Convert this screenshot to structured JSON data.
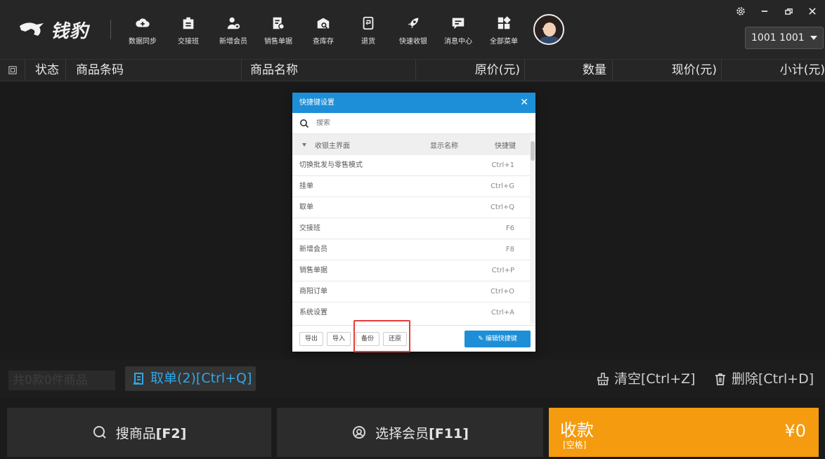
{
  "app": {
    "logo_text": "钱豹"
  },
  "toolbar": [
    {
      "label": "数据同步",
      "icon": "cloud-sync-icon"
    },
    {
      "label": "交接班",
      "icon": "handover-icon"
    },
    {
      "label": "新增会员",
      "icon": "add-member-icon"
    },
    {
      "label": "销售单据",
      "icon": "sales-doc-icon"
    },
    {
      "label": "查库存",
      "icon": "inventory-icon"
    },
    {
      "label": "退货",
      "icon": "return-icon"
    },
    {
      "label": "快速收银",
      "icon": "rocket-icon"
    },
    {
      "label": "消息中心",
      "icon": "message-icon"
    },
    {
      "label": "全部菜单",
      "icon": "grid-menu-icon"
    }
  ],
  "user": {
    "selector": "1001 1001"
  },
  "table": {
    "headers": [
      "状态",
      "商品条码",
      "商品名称",
      "原价(元)",
      "数量",
      "现价(元)",
      "小计(元)"
    ]
  },
  "summary": {
    "ghost": "共0款0件商品",
    "take_order": "取单(2)[Ctrl+Q]",
    "clear": "清空[Ctrl+Z]",
    "delete": "删除[Ctrl+D]"
  },
  "bottom": {
    "search_label": "搜商品",
    "search_key": "[F2]",
    "member_label": "选择会员",
    "member_key": "[F11]",
    "pay_title": "收款",
    "pay_sub": "[空格]",
    "pay_amount": "¥0"
  },
  "dialog": {
    "title": "快捷键设置",
    "search_placeholder": "搜索",
    "group_label": "收银主界面",
    "col_display": "显示名称",
    "col_key": "快捷键",
    "rows": [
      {
        "name": "切换批发与零售模式",
        "key": "Ctrl+1"
      },
      {
        "name": "挂单",
        "key": "Ctrl+G"
      },
      {
        "name": "取单",
        "key": "Ctrl+Q"
      },
      {
        "name": "交接班",
        "key": "F6"
      },
      {
        "name": "新增会员",
        "key": "F8"
      },
      {
        "name": "销售单据",
        "key": "Ctrl+P"
      },
      {
        "name": "商阳订单",
        "key": "Ctrl+O"
      },
      {
        "name": "系统设置",
        "key": "Ctrl+A"
      }
    ],
    "buttons": {
      "export": "导出",
      "import": "导入",
      "backup": "备份",
      "restore": "还原",
      "edit": "编辑快捷键"
    }
  }
}
